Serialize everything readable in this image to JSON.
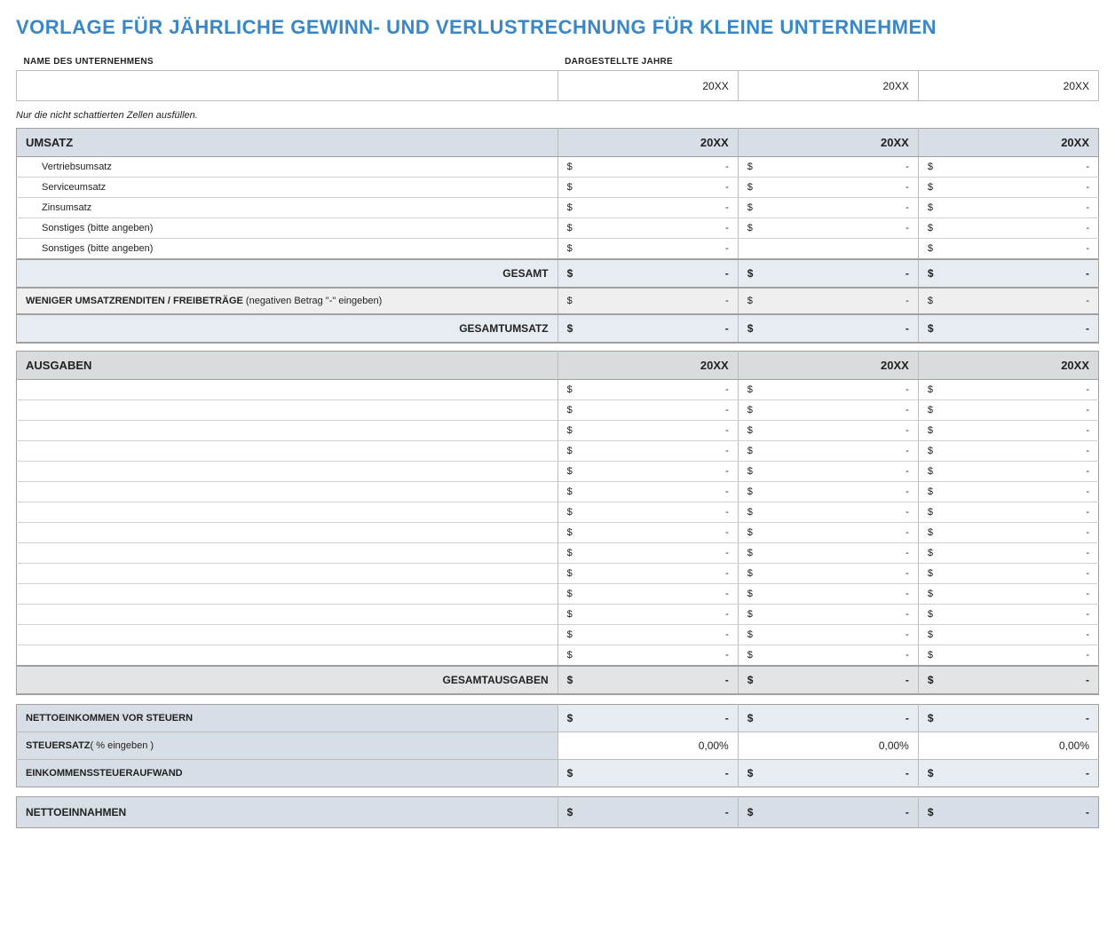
{
  "title": "VORLAGE FÜR JÄHRLICHE GEWINN- UND VERLUSTRECHNUNG FÜR KLEINE UNTERNEHMEN",
  "meta": {
    "company_label": "NAME DES UNTERNEHMENS",
    "years_label": "DARGESTELLTE JAHRE",
    "year1": "20XX",
    "year2": "20XX",
    "year3": "20XX"
  },
  "note": "Nur die nicht schattierten Zellen ausfüllen.",
  "currency": "$",
  "dash": "-",
  "pct": "0,00%",
  "revenue": {
    "header": "UMSATZ",
    "rows": [
      "Vertriebsumsatz",
      "Serviceumsatz",
      "Zinsumsatz",
      "Sonstiges (bitte angeben)",
      "Sonstiges (bitte angeben)"
    ],
    "total": "GESAMT",
    "less_label": "WENIGER UMSATZRENDITEN / FREIBETRÄGE",
    "less_suffix": " (negativen Betrag \"-\" eingeben)",
    "grand_total": "GESAMTUMSATZ"
  },
  "expenses": {
    "header": "AUSGABEN",
    "row_count": 14,
    "total": "GESAMTAUSGABEN"
  },
  "summary": {
    "pre_tax": "NETTOEINKOMMEN VOR STEUERN",
    "tax_rate": "STEUERSATZ",
    "tax_rate_suffix": "( % eingeben )",
    "tax_expense": "EINKOMMENSSTEUERAUFWAND"
  },
  "net_income": "NETTOEINNAHMEN"
}
